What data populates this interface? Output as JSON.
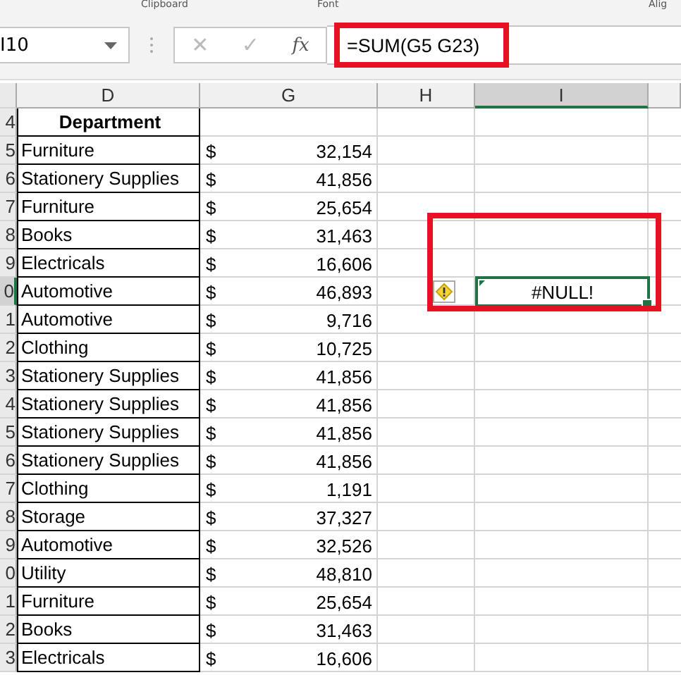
{
  "ribbon_groups": [
    "Clipboard",
    "Font",
    "Alig"
  ],
  "formula_bar": {
    "name_box": "I10",
    "cancel": "✕",
    "enter": "✓",
    "function": "fx",
    "formula": "=SUM(G5 G23)"
  },
  "columns": [
    {
      "label": "D",
      "selected": false
    },
    {
      "label": "G",
      "selected": false
    },
    {
      "label": "H",
      "selected": false
    },
    {
      "label": "I",
      "selected": true
    }
  ],
  "rows": [
    {
      "num": "4",
      "dept": "Department",
      "dollar": "",
      "amount": "",
      "header": true
    },
    {
      "num": "5",
      "dept": "Furniture",
      "dollar": "$",
      "amount": "32,154",
      "header": false
    },
    {
      "num": "6",
      "dept": "Stationery Supplies",
      "dollar": "$",
      "amount": "41,856",
      "header": false
    },
    {
      "num": "7",
      "dept": "Furniture",
      "dollar": "$",
      "amount": "25,654",
      "header": false
    },
    {
      "num": "8",
      "dept": "Books",
      "dollar": "$",
      "amount": "31,463",
      "header": false
    },
    {
      "num": "9",
      "dept": "Electricals",
      "dollar": "$",
      "amount": "16,606",
      "header": false
    },
    {
      "num": "0",
      "dept": "Automotive",
      "dollar": "$",
      "amount": "46,893",
      "header": false,
      "error": "#NULL!"
    },
    {
      "num": "1",
      "dept": "Automotive",
      "dollar": "$",
      "amount": "9,716",
      "header": false
    },
    {
      "num": "2",
      "dept": "Clothing",
      "dollar": "$",
      "amount": "10,725",
      "header": false
    },
    {
      "num": "3",
      "dept": "Stationery Supplies",
      "dollar": "$",
      "amount": "41,856",
      "header": false
    },
    {
      "num": "4",
      "dept": "Stationery Supplies",
      "dollar": "$",
      "amount": "41,856",
      "header": false
    },
    {
      "num": "5",
      "dept": "Stationery Supplies",
      "dollar": "$",
      "amount": "41,856",
      "header": false
    },
    {
      "num": "6",
      "dept": "Stationery Supplies",
      "dollar": "$",
      "amount": "41,856",
      "header": false
    },
    {
      "num": "7",
      "dept": "Clothing",
      "dollar": "$",
      "amount": "1,191",
      "header": false
    },
    {
      "num": "8",
      "dept": "Storage",
      "dollar": "$",
      "amount": "37,327",
      "header": false
    },
    {
      "num": "9",
      "dept": "Automotive",
      "dollar": "$",
      "amount": "32,526",
      "header": false
    },
    {
      "num": "0",
      "dept": "Utility",
      "dollar": "$",
      "amount": "48,810",
      "header": false
    },
    {
      "num": "1",
      "dept": "Furniture",
      "dollar": "$",
      "amount": "25,654",
      "header": false
    },
    {
      "num": "2",
      "dept": "Books",
      "dollar": "$",
      "amount": "31,463",
      "header": false
    },
    {
      "num": "3",
      "dept": "Electricals",
      "dollar": "$",
      "amount": "16,606",
      "header": false
    }
  ]
}
